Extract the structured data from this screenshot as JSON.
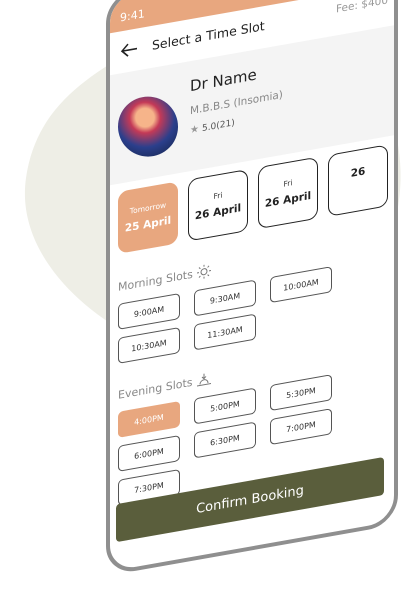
{
  "status": {
    "time": "9:41"
  },
  "header": {
    "title": "Select a Time Slot",
    "fee": "Fee: $400"
  },
  "doctor": {
    "name": "Dr Name",
    "degree": "M.B.B.S (Insomia)",
    "rating": "5.0(21)"
  },
  "dates": [
    {
      "day": "Tomorrow",
      "date": "25 April",
      "active": true
    },
    {
      "day": "Fri",
      "date": "26 April",
      "active": false
    },
    {
      "day": "Fri",
      "date": "26 April",
      "active": false
    },
    {
      "day": "",
      "date": "26",
      "active": false
    }
  ],
  "morning": {
    "label": "Morning Slots",
    "slots": [
      "9:00AM",
      "9:30AM",
      "10:00AM",
      "10:30AM",
      "11:30AM"
    ]
  },
  "evening": {
    "label": "Evening Slots",
    "slots": [
      "4:00PM",
      "5:00PM",
      "5:30PM",
      "6:00PM",
      "6:30PM",
      "7:00PM",
      "7:30PM"
    ],
    "selected": "4:00PM"
  },
  "confirm_label": "Confirm Booking",
  "colors": {
    "accent": "#e8a77f",
    "button": "#5a5e3c",
    "blob": "#eeeee6",
    "frame": "#8f8f8f"
  }
}
